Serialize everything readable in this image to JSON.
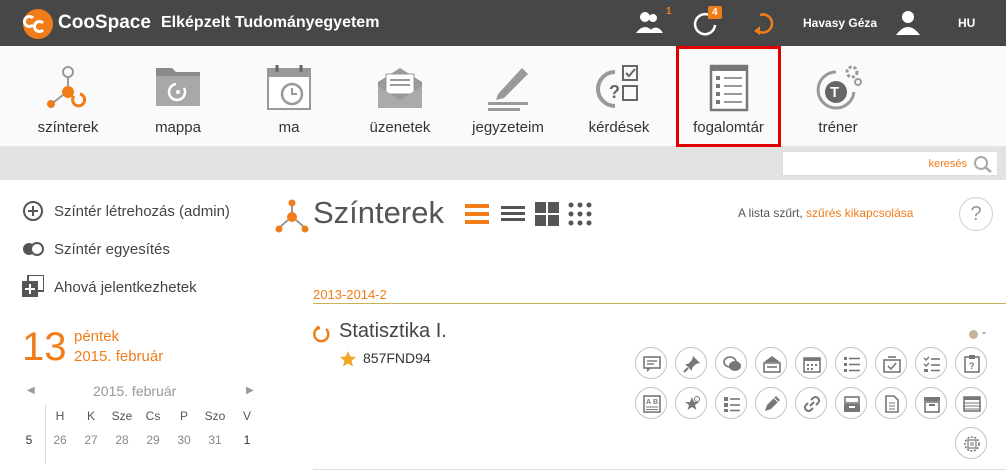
{
  "app": {
    "brand": "CooSpace",
    "university": "Elképzelt Tudományegyetem",
    "notif_people_count": "1",
    "notif_sync_count": "4",
    "username": "Havasy Géza",
    "lang": "HU",
    "brand_color": "#f07d1a"
  },
  "toolbar": {
    "items": [
      {
        "label": "színterek",
        "icon": "scenes-icon"
      },
      {
        "label": "mappa",
        "icon": "folder-icon"
      },
      {
        "label": "ma",
        "icon": "calendar-today-icon"
      },
      {
        "label": "üzenetek",
        "icon": "envelope-icon"
      },
      {
        "label": "jegyzeteim",
        "icon": "pencil-notes-icon"
      },
      {
        "label": "kérdések",
        "icon": "quiz-icon"
      },
      {
        "label": "fogalomtár",
        "icon": "glossary-icon",
        "selected": true
      },
      {
        "label": "tréner",
        "icon": "trainer-icon"
      }
    ]
  },
  "search": {
    "placeholder": "keresés"
  },
  "sidebar": {
    "actions": [
      {
        "label": "Színtér létrehozás (admin)",
        "icon": "plus-circle-icon"
      },
      {
        "label": "Színtér egyesítés",
        "icon": "merge-icon"
      },
      {
        "label": "Ahová jelentkezhetek",
        "icon": "add-box-icon"
      }
    ],
    "today": {
      "day": "13",
      "weekday": "péntek",
      "date": "2015. február"
    },
    "calendar": {
      "month": "2015. február",
      "prev": "◀",
      "next": "▶",
      "headers": [
        "H",
        "K",
        "Sze",
        "Cs",
        "P",
        "Szo",
        "V"
      ],
      "week_num": "5",
      "row": [
        "26",
        "27",
        "28",
        "29",
        "30",
        "31",
        "1"
      ]
    }
  },
  "main": {
    "title": "Színterek",
    "filter_text": "A lista szűrt,",
    "filter_link": "szűrés kikapcsolása",
    "help": "?",
    "semester": "2013-2014-2",
    "course": {
      "title": "Statisztika I.",
      "code": "857FND94",
      "status": "-"
    },
    "course_buttons": [
      "forum-icon",
      "pin-icon",
      "chat-icon",
      "inbox-icon",
      "calendar-icon",
      "list-icon",
      "task-icon",
      "checklist-icon",
      "clipboard-icon",
      "glossary-ab-icon",
      "star-badge-icon",
      "bullet-list-icon",
      "pen-icon",
      "link-icon",
      "archive-icon",
      "document-icon",
      "box-icon",
      "table-icon",
      "settings-icon"
    ]
  }
}
